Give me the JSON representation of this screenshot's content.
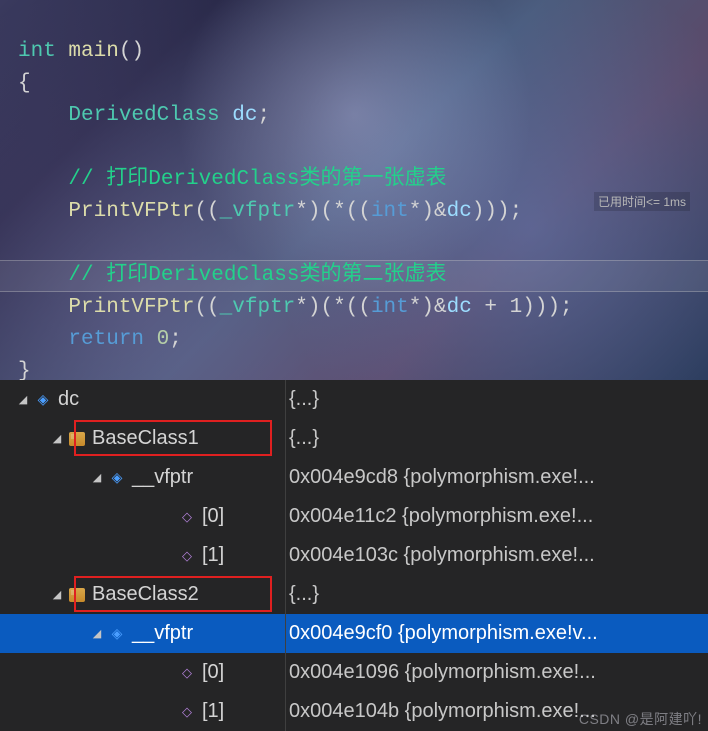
{
  "code": {
    "l1_type": "int",
    "l1_fn": "main",
    "l1_parens": "()",
    "l2": "{",
    "l3_type": "DerivedClass",
    "l3_var": "dc",
    "l3_end": ";",
    "c1": "// 打印DerivedClass类的第一张虚表",
    "p1_fn": "PrintVFPtr",
    "p1_cast_type": "_vfptr",
    "p1_int": "int",
    "p1_dc": "dc",
    "timing": "已用时间<= 1ms",
    "c2": "// 打印DerivedClass类的第二张虚表",
    "p2_plus1": " + 1",
    "ret_kw": "return",
    "ret_val": "0",
    "close": "}"
  },
  "watch": {
    "dc": {
      "name": "dc",
      "value": "{...}"
    },
    "base1": {
      "name": "BaseClass1",
      "value": "{...}"
    },
    "vfptr1": {
      "name": "__vfptr",
      "value": "0x004e9cd8 {polymorphism.exe!..."
    },
    "b1_0": {
      "name": "[0]",
      "value": "0x004e11c2 {polymorphism.exe!..."
    },
    "b1_1": {
      "name": "[1]",
      "value": "0x004e103c {polymorphism.exe!..."
    },
    "base2": {
      "name": "BaseClass2",
      "value": "{...}"
    },
    "vfptr2": {
      "name": "__vfptr",
      "value": "0x004e9cf0 {polymorphism.exe!v..."
    },
    "b2_0": {
      "name": "[0]",
      "value": "0x004e1096 {polymorphism.exe!..."
    },
    "b2_1": {
      "name": "[1]",
      "value": "0x004e104b {polymorphism.exe!..."
    }
  },
  "watermark": "CSDN @是阿建吖!"
}
